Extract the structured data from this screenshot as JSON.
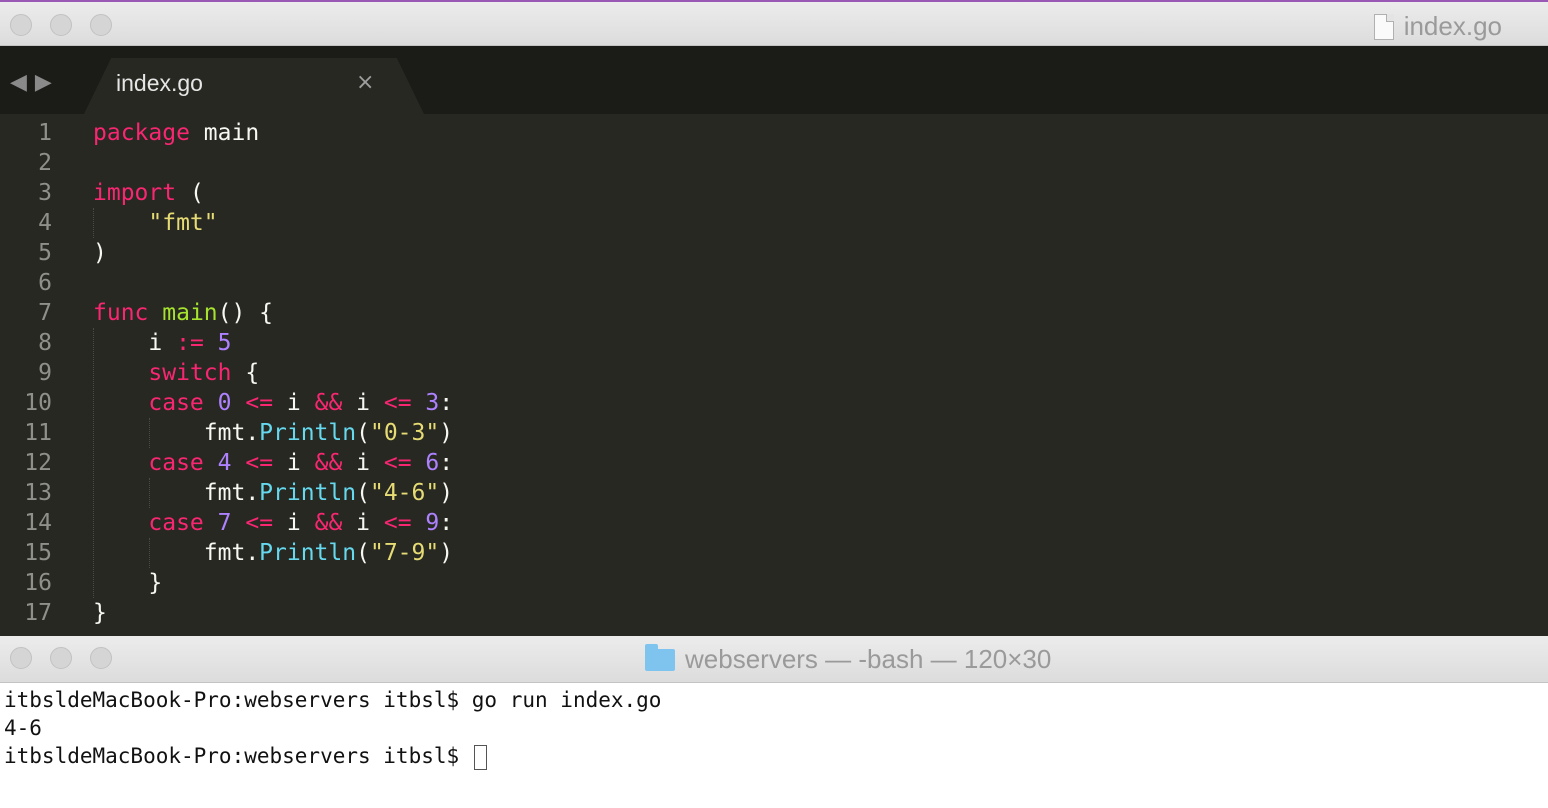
{
  "editor": {
    "window_title": "index.go",
    "tab": {
      "label": "index.go",
      "close_glyph": "×"
    },
    "nav": {
      "back_glyph": "◀",
      "forward_glyph": "▶"
    },
    "lines": [
      {
        "n": "1",
        "tokens": [
          {
            "t": "package",
            "c": "kw"
          },
          {
            "t": " main",
            "c": ""
          }
        ]
      },
      {
        "n": "2",
        "tokens": []
      },
      {
        "n": "3",
        "tokens": [
          {
            "t": "import",
            "c": "kw"
          },
          {
            "t": " (",
            "c": ""
          }
        ]
      },
      {
        "n": "4",
        "tokens": [
          {
            "t": "    ",
            "c": ""
          },
          {
            "t": "\"fmt\"",
            "c": "str"
          }
        ]
      },
      {
        "n": "5",
        "tokens": [
          {
            "t": ")",
            "c": ""
          }
        ]
      },
      {
        "n": "6",
        "tokens": []
      },
      {
        "n": "7",
        "tokens": [
          {
            "t": "func",
            "c": "kw"
          },
          {
            "t": " ",
            "c": ""
          },
          {
            "t": "main",
            "c": "fn"
          },
          {
            "t": "() {",
            "c": ""
          }
        ]
      },
      {
        "n": "8",
        "tokens": [
          {
            "t": "    i ",
            "c": ""
          },
          {
            "t": ":=",
            "c": "kw"
          },
          {
            "t": " ",
            "c": ""
          },
          {
            "t": "5",
            "c": "num"
          }
        ]
      },
      {
        "n": "9",
        "tokens": [
          {
            "t": "    ",
            "c": ""
          },
          {
            "t": "switch",
            "c": "kw"
          },
          {
            "t": " {",
            "c": ""
          }
        ]
      },
      {
        "n": "10",
        "tokens": [
          {
            "t": "    ",
            "c": ""
          },
          {
            "t": "case",
            "c": "kw"
          },
          {
            "t": " ",
            "c": ""
          },
          {
            "t": "0",
            "c": "num"
          },
          {
            "t": " ",
            "c": ""
          },
          {
            "t": "<=",
            "c": "kw"
          },
          {
            "t": " i ",
            "c": ""
          },
          {
            "t": "&&",
            "c": "kw"
          },
          {
            "t": " i ",
            "c": ""
          },
          {
            "t": "<=",
            "c": "kw"
          },
          {
            "t": " ",
            "c": ""
          },
          {
            "t": "3",
            "c": "num"
          },
          {
            "t": ":",
            "c": ""
          }
        ]
      },
      {
        "n": "11",
        "tokens": [
          {
            "t": "        fmt.",
            "c": ""
          },
          {
            "t": "Println",
            "c": "meth"
          },
          {
            "t": "(",
            "c": ""
          },
          {
            "t": "\"0-3\"",
            "c": "str"
          },
          {
            "t": ")",
            "c": ""
          }
        ]
      },
      {
        "n": "12",
        "tokens": [
          {
            "t": "    ",
            "c": ""
          },
          {
            "t": "case",
            "c": "kw"
          },
          {
            "t": " ",
            "c": ""
          },
          {
            "t": "4",
            "c": "num"
          },
          {
            "t": " ",
            "c": ""
          },
          {
            "t": "<=",
            "c": "kw"
          },
          {
            "t": " i ",
            "c": ""
          },
          {
            "t": "&&",
            "c": "kw"
          },
          {
            "t": " i ",
            "c": ""
          },
          {
            "t": "<=",
            "c": "kw"
          },
          {
            "t": " ",
            "c": ""
          },
          {
            "t": "6",
            "c": "num"
          },
          {
            "t": ":",
            "c": ""
          }
        ]
      },
      {
        "n": "13",
        "tokens": [
          {
            "t": "        fmt.",
            "c": ""
          },
          {
            "t": "Println",
            "c": "meth"
          },
          {
            "t": "(",
            "c": ""
          },
          {
            "t": "\"4-6\"",
            "c": "str"
          },
          {
            "t": ")",
            "c": ""
          }
        ]
      },
      {
        "n": "14",
        "tokens": [
          {
            "t": "    ",
            "c": ""
          },
          {
            "t": "case",
            "c": "kw"
          },
          {
            "t": " ",
            "c": ""
          },
          {
            "t": "7",
            "c": "num"
          },
          {
            "t": " ",
            "c": ""
          },
          {
            "t": "<=",
            "c": "kw"
          },
          {
            "t": " i ",
            "c": ""
          },
          {
            "t": "&&",
            "c": "kw"
          },
          {
            "t": " i ",
            "c": ""
          },
          {
            "t": "<=",
            "c": "kw"
          },
          {
            "t": " ",
            "c": ""
          },
          {
            "t": "9",
            "c": "num"
          },
          {
            "t": ":",
            "c": ""
          }
        ]
      },
      {
        "n": "15",
        "tokens": [
          {
            "t": "        fmt.",
            "c": ""
          },
          {
            "t": "Println",
            "c": "meth"
          },
          {
            "t": "(",
            "c": ""
          },
          {
            "t": "\"7-9\"",
            "c": "str"
          },
          {
            "t": ")",
            "c": ""
          }
        ]
      },
      {
        "n": "16",
        "tokens": [
          {
            "t": "    }",
            "c": ""
          }
        ]
      },
      {
        "n": "17",
        "tokens": [
          {
            "t": "}",
            "c": ""
          }
        ]
      }
    ]
  },
  "terminal": {
    "window_title": "webservers — -bash — 120×30",
    "lines": [
      "itbsldeMacBook-Pro:webservers itbsl$ go run index.go",
      "4-6",
      "itbsldeMacBook-Pro:webservers itbsl$ "
    ]
  },
  "colors": {
    "editor_bg": "#272822",
    "keyword": "#f92672",
    "function": "#a6e22e",
    "string": "#e6db74",
    "number": "#ae81ff",
    "method": "#66d9ef"
  }
}
